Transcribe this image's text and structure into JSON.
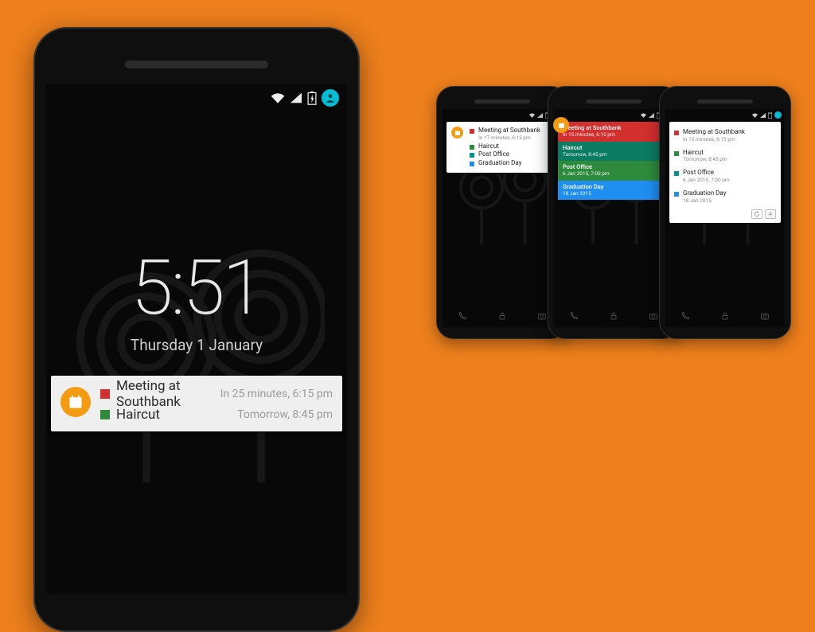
{
  "colors": {
    "background": "#ed7f1c",
    "accent": "#f39c12",
    "user_badge": "#00bcd4",
    "red": "#d32f2f",
    "green": "#2e8b3d",
    "darkgreen": "#0b7b62",
    "teal": "#009688",
    "blue": "#1f8ef1"
  },
  "main_phone": {
    "clock": "5:51",
    "date": "Thursday 1 January",
    "status_icons": [
      "wifi-icon",
      "signal-icon",
      "battery-icon",
      "user-icon"
    ],
    "notification": {
      "icon": "calendar-icon",
      "items": [
        {
          "color": "#d32f2f",
          "title": "Meeting at Southbank",
          "sub": "In 25 minutes, 6:15 pm"
        },
        {
          "color": "#2e8b3d",
          "title": "Haircut",
          "sub": "Tomorrow, 8:45 pm"
        }
      ]
    }
  },
  "small_phones": {
    "a": {
      "style": "compact-list",
      "icon": "calendar-icon",
      "items": [
        {
          "color": "#d32f2f",
          "title": "Meeting at Southbank",
          "sub": "In 17 minutes, 6:15 pm"
        },
        {
          "color": "#2e8b3d",
          "title": "Haircut",
          "sub": ""
        },
        {
          "color": "#009688",
          "title": "Post Office",
          "sub": ""
        },
        {
          "color": "#1f8ef1",
          "title": "Graduation Day",
          "sub": ""
        }
      ]
    },
    "b": {
      "style": "color-bars",
      "icon": "calendar-icon",
      "items": [
        {
          "color": "#d32f2f",
          "title": "Meeting at Southbank",
          "sub": "In 15 minutes, 6:15 pm"
        },
        {
          "color": "#0b7b62",
          "title": "Haircut",
          "sub": "Tomorrow, 8:45 pm"
        },
        {
          "color": "#2e8b3d",
          "title": "Post Office",
          "sub": "6 Jan 2015, 7:00 pm"
        },
        {
          "color": "#1f8ef1",
          "title": "Graduation Day",
          "sub": "18 Jan 2015"
        }
      ]
    },
    "c": {
      "style": "spaced-list",
      "icon": "calendar-icon",
      "items": [
        {
          "color": "#d32f2f",
          "title": "Meeting at Southbank",
          "sub": "In 15 minutes, 6:15 pm"
        },
        {
          "color": "#2e8b3d",
          "title": "Haircut",
          "sub": "Tomorrow, 8:45 pm"
        },
        {
          "color": "#009688",
          "title": "Post Office",
          "sub": "6 Jan 2015, 7:00 pm"
        },
        {
          "color": "#1f8ef1",
          "title": "Graduation Day",
          "sub": "18 Jan 2015"
        }
      ],
      "buttons": [
        "refresh-icon",
        "settings-icon"
      ]
    }
  },
  "nav_icons": [
    "phone-icon",
    "lock-icon",
    "camera-icon"
  ]
}
